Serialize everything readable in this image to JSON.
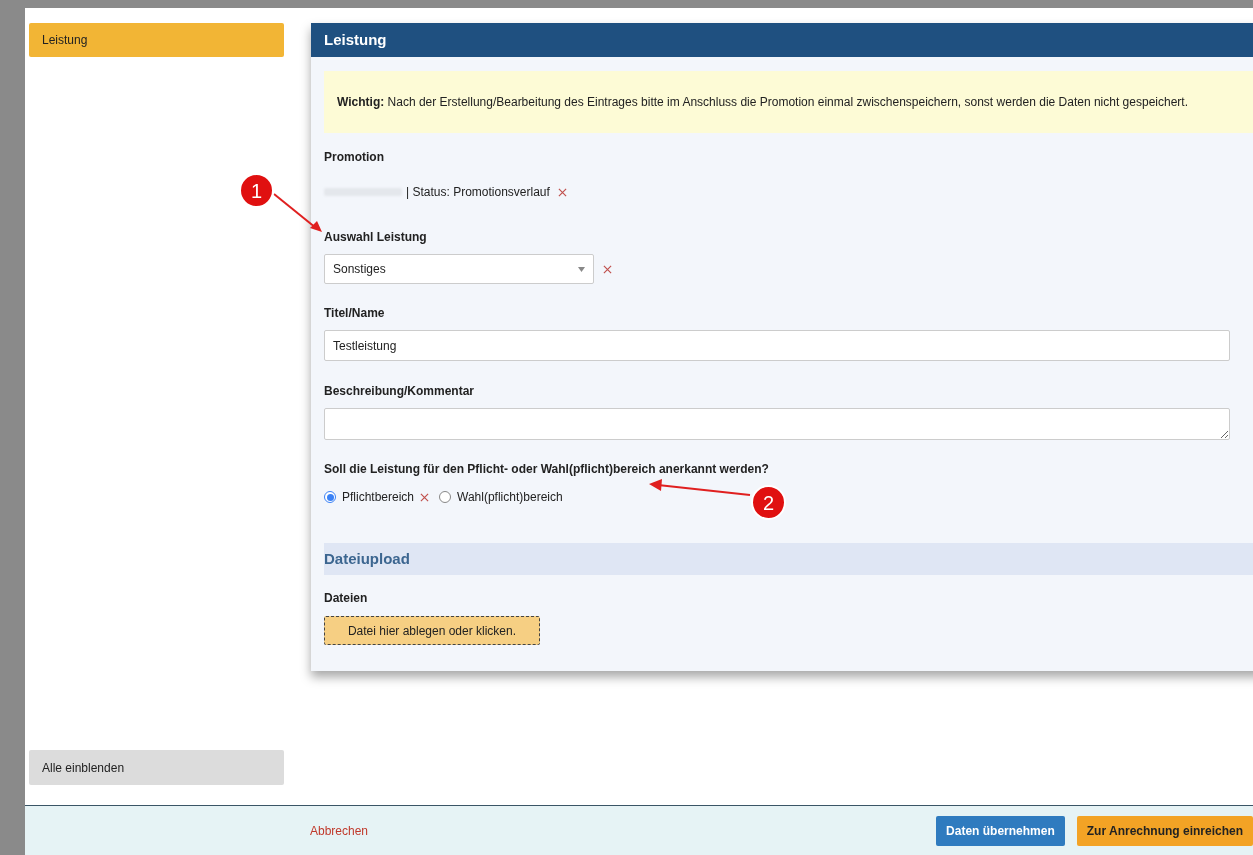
{
  "sidebar": {
    "items": [
      {
        "label": "Leistung",
        "selected": true
      }
    ],
    "show_all_button": "Alle einblenden"
  },
  "panel": {
    "title": "Leistung",
    "notice": "**Wichtig:** Nach der Erstellung/Bearbeitung des Eintrages bitte im Anschluss die Promotion einmal zwischenspeichern, sonst werden die Daten nicht gespeichert.",
    "promotion": {
      "label": "Promotion",
      "value": "| Status: Promotionsverlauf"
    },
    "selection": {
      "label": "Auswahl Leistung",
      "value": "Sonstiges"
    },
    "title_field": {
      "label": "Titel/Name",
      "value": "Testleistung"
    },
    "description_field": {
      "label": "Beschreibung/Kommentar"
    },
    "area_question": {
      "label": "Soll die Leistung für den Pflicht- oder Wahl(pflicht)bereich anerkannt werden?",
      "options": [
        {
          "label": "Pflichtbereich",
          "selected": true
        },
        {
          "label": "Wahl(pflicht)bereich",
          "selected": false
        }
      ]
    },
    "upload": {
      "heading": "Dateiupload",
      "label": "Dateien",
      "dropzone": "Datei hier ablegen oder klicken."
    }
  },
  "footer": {
    "cancel": "Abbrechen",
    "buttons": [
      {
        "label": "Daten übernehmen",
        "kind": "primary"
      },
      {
        "label": "Zur Anrechnung einreichen",
        "kind": "warning"
      }
    ]
  },
  "annotations": [
    {
      "label": "1"
    },
    {
      "label": "2"
    }
  ]
}
